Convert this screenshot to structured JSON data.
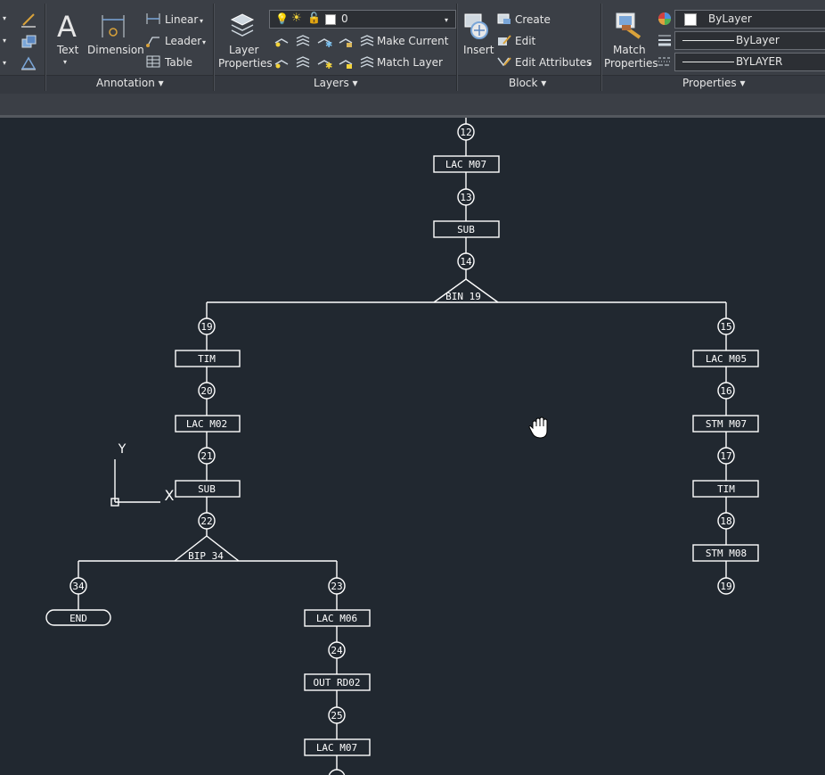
{
  "ribbon": {
    "annotation": {
      "text": "Text",
      "dimension": "Dimension",
      "linear": "Linear",
      "leader": "Leader",
      "table": "Table",
      "title": "Annotation"
    },
    "layers": {
      "layer_properties_1": "Layer",
      "layer_properties_2": "Properties",
      "current_layer": "0",
      "make_current": "Make Current",
      "match_layer": "Match Layer",
      "title": "Layers"
    },
    "block": {
      "insert": "Insert",
      "create": "Create",
      "edit": "Edit",
      "edit_attributes": "Edit Attributes",
      "title": "Block"
    },
    "properties": {
      "match_1": "Match",
      "match_2": "Properties",
      "color": "ByLayer",
      "linetype": "ByLayer",
      "lineweight": "BYLAYER",
      "title": "Properties"
    }
  },
  "drawing": {
    "nodes": {
      "n12": "12",
      "n13": "13",
      "n14": "14",
      "n19a": "19",
      "n20": "20",
      "n21": "21",
      "n22": "22",
      "n15": "15",
      "n16": "16",
      "n17": "17",
      "n18": "18",
      "n19b": "19",
      "n34": "34",
      "n23": "23",
      "n24": "24",
      "n25": "25"
    },
    "boxes": {
      "lac_m07_top": "LAC M07",
      "sub_top": "SUB",
      "tim_left": "TIM",
      "lac_m02": "LAC M02",
      "sub_left": "SUB",
      "lac_m05": "LAC M05",
      "stm_m07": "STM M07",
      "tim_right": "TIM",
      "stm_m08": "STM M08",
      "lac_m06": "LAC M06",
      "out_rd02": "OUT RD02",
      "lac_m07_bottom": "LAC M07",
      "end": "END"
    },
    "branches": {
      "bin_19": "BIN 19",
      "bip_34": "BIP 34"
    },
    "ucs": {
      "x": "X",
      "y": "Y"
    }
  },
  "colors": {
    "background": "#212830",
    "ribbon": "#3b3f46",
    "stroke": "#ffffff"
  }
}
